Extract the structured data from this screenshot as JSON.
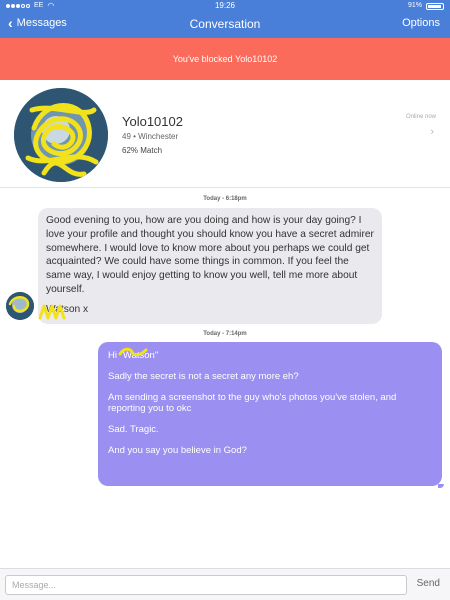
{
  "status_bar": {
    "carrier": "EE",
    "time": "19:26",
    "battery_percent": "91%"
  },
  "nav": {
    "back_label": "Messages",
    "title": "Conversation",
    "options_label": "Options"
  },
  "banner": {
    "text": "You've blocked Yolo10102"
  },
  "profile": {
    "username": "Yolo10102",
    "meta": "49 • Winchester",
    "match": "62% Match",
    "online_status": "Online now"
  },
  "messages": [
    {
      "timestamp": "Today - 6:18pm",
      "direction": "incoming",
      "text": "Good evening to you, how are you doing and how is your day going? I love your profile and thought you should know you have a secret admirer somewhere. I would love to know more about you perhaps we could get acquainted? We could have some things in common. If you feel the same way, I would enjoy getting to know you well, tell me more about yourself.",
      "signature": "Watson x"
    },
    {
      "timestamp": "Today - 7:14pm",
      "direction": "outgoing",
      "lines": [
        "Hi \"Watson\"",
        "Sadly the secret is not a secret any more eh?",
        "Am sending a screenshot to the guy who's photos you've stolen, and reporting you to okc",
        "Sad. Tragic.",
        "And you say you believe in God?"
      ]
    }
  ],
  "composer": {
    "placeholder": "Message...",
    "send_label": "Send"
  },
  "colors": {
    "nav_blue": "#4a7fd9",
    "banner_red": "#fa6b5b",
    "outgoing_bubble": "#9c8ff2",
    "incoming_bubble": "#e9e9ee",
    "scribble_yellow": "#f2e21b"
  }
}
